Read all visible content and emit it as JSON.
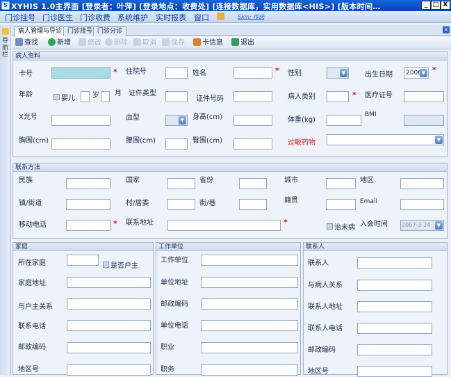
{
  "window": {
    "title": "XYHIS 1.0主界面 [登录者：叶萍] [登录地点：收费处] [连接数据库，实用数据库<HIS>] [版本时间…",
    "min": "_",
    "max": "□",
    "close": "X"
  },
  "menu": {
    "items": [
      "门诊挂号",
      "门诊医生",
      "门诊收费",
      "系统维护",
      "实时报表",
      "窗口"
    ],
    "skin": "Skin: 传统"
  },
  "sidetab": {
    "label": "导航栏"
  },
  "tabs": [
    "病人管理与导诊",
    "门诊挂号",
    "门诊分诊"
  ],
  "toolbar": {
    "query": "查找",
    "add": "新增",
    "edit": "修改",
    "delete": "删除",
    "cancel": "取消",
    "save": "保存",
    "card": "卡信息",
    "exit": "退出"
  },
  "patient": {
    "header": "病人资料",
    "card_no": "卡号",
    "inpatient_no": "住院号",
    "name": "姓名",
    "gender": "性别",
    "birth": "出生日期",
    "birth_year": "2006",
    "age": "年龄",
    "infant": "婴儿",
    "year_unit": "岁",
    "month_unit": "月",
    "id_type": "证件类型",
    "id_no": "证件号码",
    "patient_type": "病人类别",
    "medical_card": "医疗证号",
    "xray": "X光号",
    "blood": "血型",
    "height": "身高(cm)",
    "weight": "体重(kg)",
    "bmi": "BMI",
    "chest": "胸围(cm)",
    "waist": "腰围(cm)",
    "hip": "臀围(cm)",
    "allergy": "过敏药物"
  },
  "contact": {
    "header": "联系方法",
    "nation": "民族",
    "country": "国家",
    "province": "省份",
    "city": "城市",
    "district": "地区",
    "town": "镇/街道",
    "village": "村/居委",
    "street": "街/巷",
    "origin": "籍贯",
    "email": "Email",
    "mobile": "移动电话",
    "address": "联系地址",
    "uncured": "治未病",
    "join_time": "入会时间",
    "join_date": "2007-3-24"
  },
  "family": {
    "header": "家庭",
    "family": "所在家庭",
    "is_head": "是否户主",
    "family_addr": "家庭地址",
    "relation_head": "与户主关系",
    "phone": "联系电话",
    "postcode": "邮政编码",
    "area": "地区号"
  },
  "work": {
    "header": "工作单位",
    "unit": "工作单位",
    "unit_addr": "单位地址",
    "postcode": "邮政编码",
    "phone": "单位电话",
    "job": "职业",
    "duty": "职务"
  },
  "person": {
    "header": "联系人",
    "contact": "联系人",
    "relation": "与病人关系",
    "addr": "联系人地址",
    "phone": "联系人电话",
    "postcode": "邮政编码",
    "area": "地区号"
  },
  "colors": {
    "titlebar": "#0a4fc4",
    "required": "#e01010",
    "accent": "#2a66c4"
  }
}
